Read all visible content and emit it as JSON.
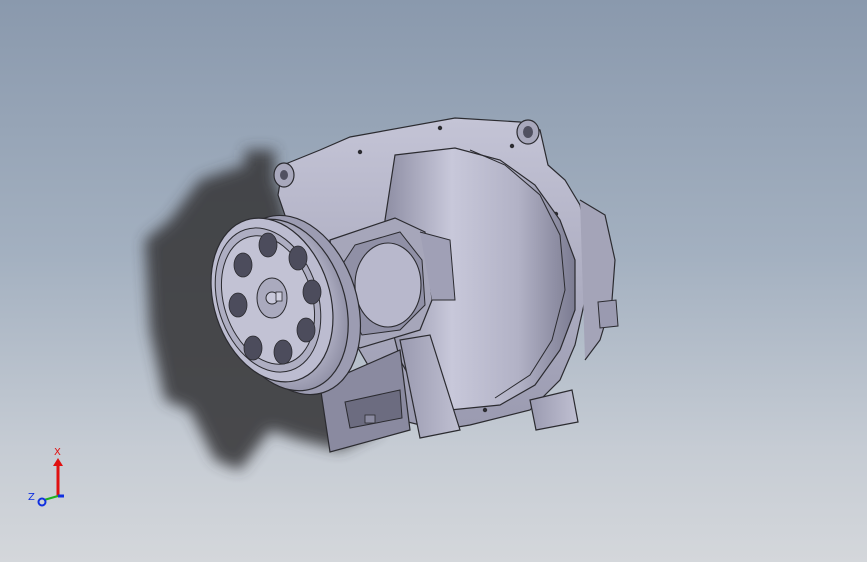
{
  "viewport": {
    "background_top": "#8a99ad",
    "background_bottom": "#d4d7db",
    "model": {
      "body_color": "#b4b4c8",
      "edge_color": "#2b2b30",
      "shadow_color": "#3a3a3e"
    }
  },
  "triad": {
    "x_label": "X",
    "z_label": "Z",
    "x_color": "#e01010",
    "y_color": "#20b020",
    "z_color": "#1030e0"
  }
}
